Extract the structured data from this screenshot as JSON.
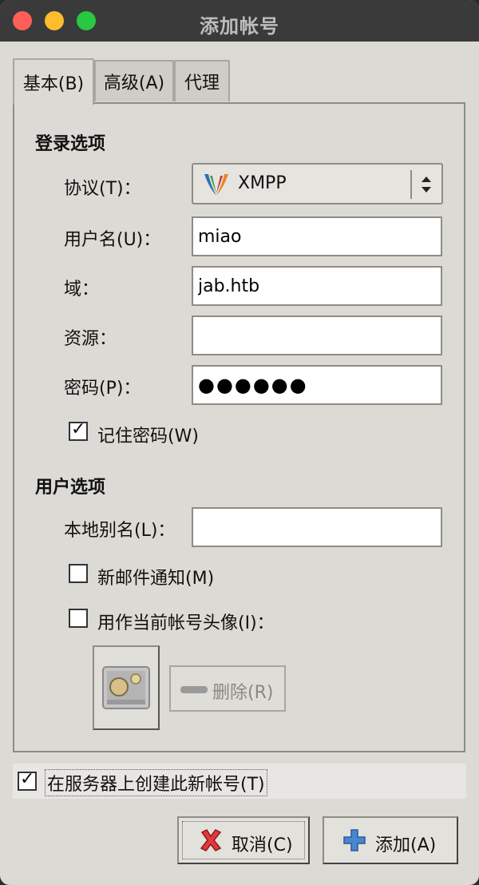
{
  "window": {
    "title": "添加帐号"
  },
  "tabs": [
    {
      "label": "基本(B)",
      "active": true
    },
    {
      "label": "高级(A)",
      "active": false
    },
    {
      "label": "代理",
      "active": false
    }
  ],
  "login": {
    "section_title": "登录选项",
    "protocol_label": "协议(T)：",
    "protocol_value": "XMPP",
    "username_label": "用户名(U)：",
    "username_value": "miao",
    "domain_label": "域：",
    "domain_value": "jab.htb",
    "resource_label": "资源：",
    "resource_value": "",
    "password_label": "密码(P)：",
    "password_value": "●●●●●●",
    "remember_label": "记住密码(W)",
    "remember_checked": true
  },
  "user": {
    "section_title": "用户选项",
    "alias_label": "本地别名(L)：",
    "alias_value": "",
    "mail_label": "新邮件通知(M)",
    "mail_checked": false,
    "avatar_label": "用作当前帐号头像(I)：",
    "avatar_checked": false,
    "delete_label": "删除(R)"
  },
  "server_create": {
    "label": "在服务器上创建此新帐号(T)",
    "checked": true
  },
  "buttons": {
    "cancel": "取消(C)",
    "add": "添加(A)"
  },
  "colors": {
    "window_bg": "#dcdad5",
    "titlebar": "#3a3a3a",
    "close": "#ff5f57",
    "minimize": "#febc2e",
    "zoom": "#28c840"
  }
}
